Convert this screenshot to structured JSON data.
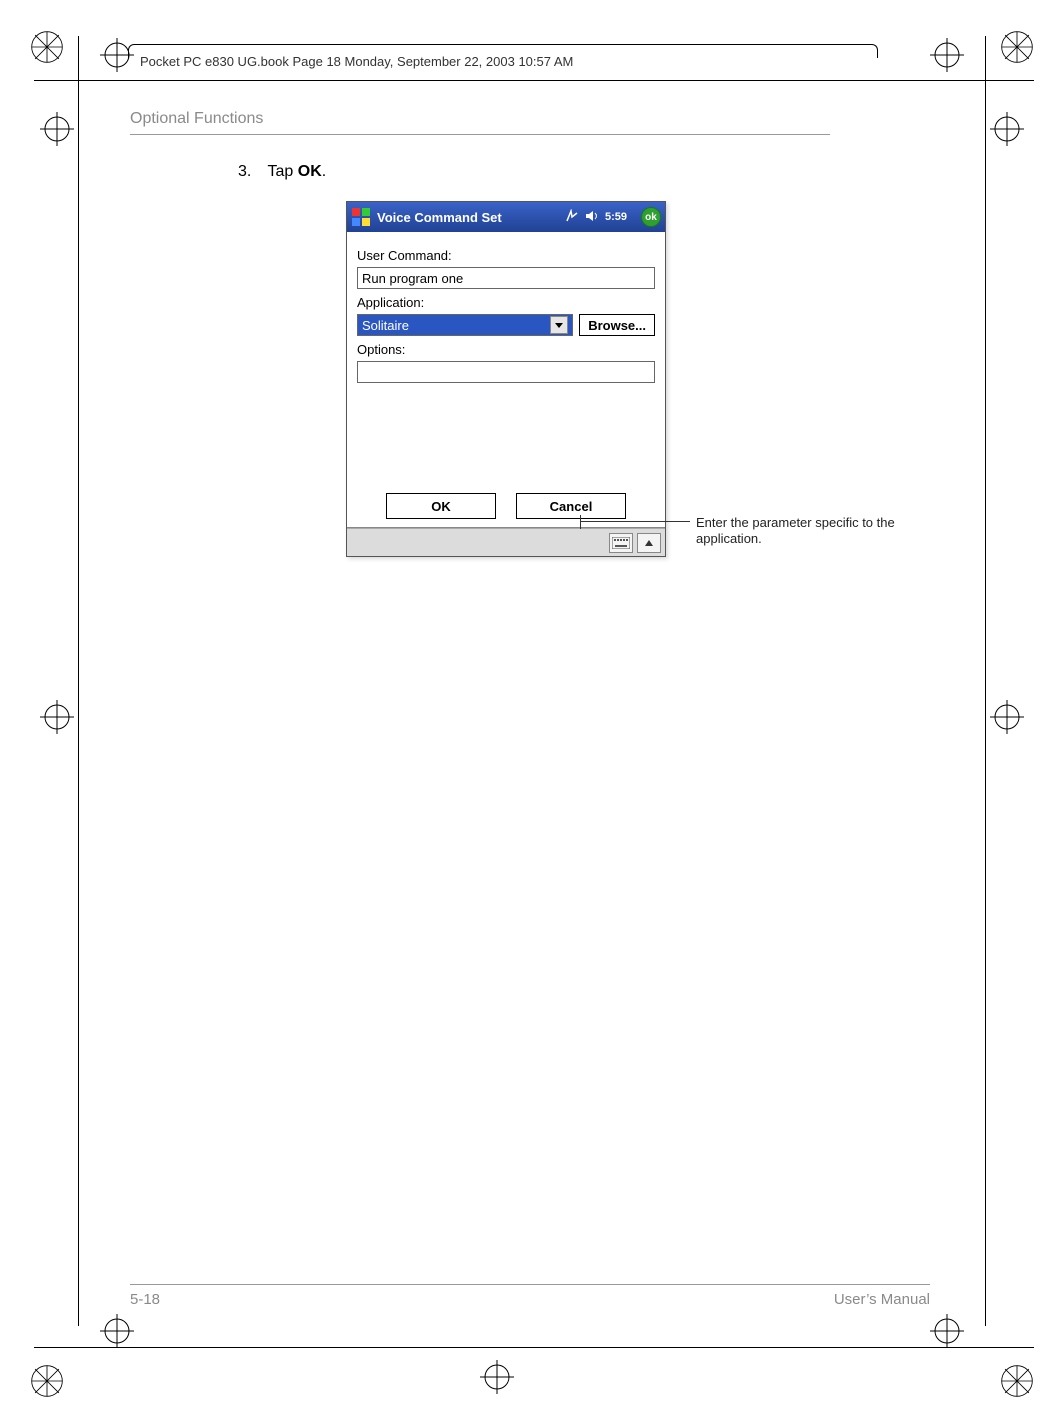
{
  "book": {
    "header_left": "Pocket PC e830 UG.book  Page 18  Monday, September 22, 2003  10:57 AM"
  },
  "section_label": "Optional Functions",
  "step": {
    "number": "3.",
    "text_prefix": "Tap ",
    "bold_word": "OK",
    "text_suffix": "."
  },
  "device": {
    "title": "Voice Command Set",
    "time": "5:59",
    "ok_badge": "ok",
    "labels": {
      "user_command": "User Command:",
      "application": "Application:",
      "options": "Options:"
    },
    "user_command_value": "Run program one",
    "application_value": "Solitaire",
    "browse_button": "Browse...",
    "options_value": "",
    "buttons": {
      "ok": "OK",
      "cancel": "Cancel"
    },
    "icons": {
      "windows_logo": "windows-logo",
      "connectivity": "connectivity-icon",
      "volume": "volume-icon",
      "keyboard": "keyboard-icon",
      "menu_up": "menu-up-icon",
      "dropdown": "dropdown-caret"
    }
  },
  "callout_text": "Enter the parameter specific to the application.",
  "footer": {
    "left": "5-18",
    "right": "User’s Manual"
  }
}
